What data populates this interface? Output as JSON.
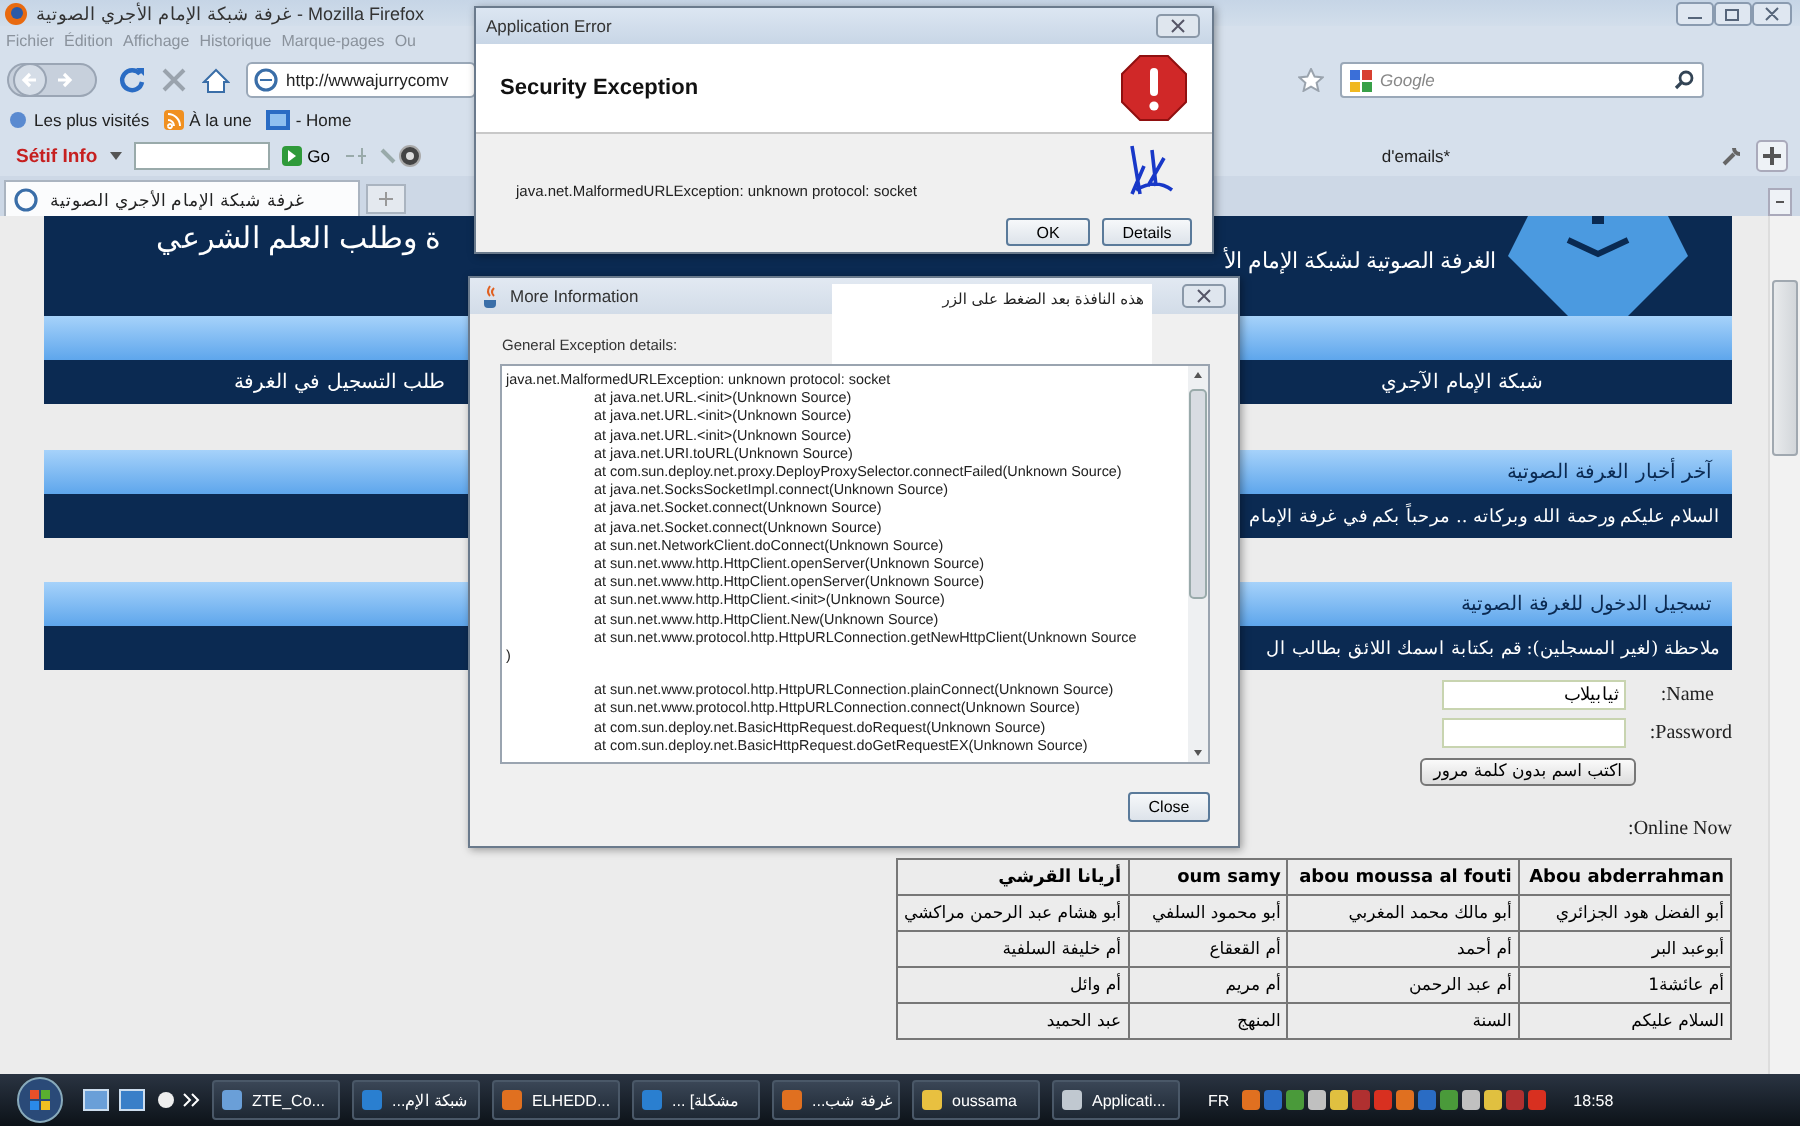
{
  "browser": {
    "title": "غرفة شبكة الإمام الأجري الصوتية - Mozilla Firefox",
    "menu": [
      "Ou",
      "Marque-pages",
      "Historique",
      "Affichage",
      "Édition",
      "Fichier"
    ],
    "address": "http://wwwajurrycomv",
    "search_placeholder": "Google",
    "bookmarks": [
      "- Home",
      "À la une",
      "Les plus visités"
    ],
    "toolbar": {
      "brand": "Sétif Info",
      "go": "Go",
      "right_text": "d'emails*"
    },
    "tabs": [
      {
        "label": "غرفة شبكة الإمام الأجري الصوتية",
        "selected": true
      }
    ]
  },
  "page": {
    "header_left": "ة وطلب العلم الشرعي",
    "header_right": "الغرفة الصوتية لشبكة الإمام الأ",
    "nav": [
      "شبكة الإمام الآجري",
      "طلب التسجيل في الغرفة"
    ],
    "news": {
      "heading": "آخر أخبار الغرفة الصوتية",
      "text": "السلام عليكم ورحمة الله وبركاته .. مرحباً بكم في غرفة الإمام"
    },
    "login": {
      "heading": "تسجيل الدخول للغرفة الصوتية",
      "note": "ملاحظة (لغير المسجلين):  قم بكتابة اسمك اللائق بطالب ال",
      "name_label": ":Name",
      "name_value": "ثيابيلاب",
      "password_label": ":Password",
      "button": "اكتب اسم بدون كلمة مرور"
    },
    "online_label": ":Online Now",
    "online_table": {
      "rows": [
        [
          "Abou abderrahman",
          "abou moussa al fouti",
          "oum samy",
          "أريانا القرشي"
        ],
        [
          "أبو الفضل هود الجزائري",
          "أبو مالك محمد المغربي",
          "أبو محمود السلفي",
          "أبو هشام عبد الرحمن مراكشي"
        ],
        [
          "أبوعبد البر",
          "أم أحمد",
          "أم القعقاع",
          "أم خليفة السلفية"
        ],
        [
          "أم عائشة1",
          "أم عبد الرحمن",
          "أم مريم",
          "أم وائل"
        ],
        [
          "السلام عليكم",
          "السنة",
          "المنهج",
          "عبد الحميد"
        ]
      ]
    }
  },
  "error_dialog": {
    "title": "Application Error",
    "heading": "Security Exception",
    "message": "java.net.MalformedURLException: unknown protocol: socket",
    "buttons": [
      "Details",
      "OK"
    ]
  },
  "details_dialog": {
    "title": "More Information",
    "note": "هذه النافذة بعد الضغط على الزر",
    "label": "General Exception details:",
    "button": "Close",
    "lines": [
      {
        "kind": "head",
        "text": "java.net.MalformedURLException: unknown protocol: socket"
      },
      {
        "kind": "frame",
        "text": "at java.net.URL.<init>(Unknown Source)"
      },
      {
        "kind": "frame",
        "text": "at java.net.URL.<init>(Unknown Source)"
      },
      {
        "kind": "frame",
        "text": "at java.net.URL.<init>(Unknown Source)"
      },
      {
        "kind": "frame",
        "text": "at java.net.URI.toURL(Unknown Source)"
      },
      {
        "kind": "frame",
        "text": "at com.sun.deploy.net.proxy.DeployProxySelector.connectFailed(Unknown Source)"
      },
      {
        "kind": "frame",
        "text": "at java.net.SocksSocketImpl.connect(Unknown Source)"
      },
      {
        "kind": "frame",
        "text": "at java.net.Socket.connect(Unknown Source)"
      },
      {
        "kind": "frame",
        "text": "at java.net.Socket.connect(Unknown Source)"
      },
      {
        "kind": "frame",
        "text": "at sun.net.NetworkClient.doConnect(Unknown Source)"
      },
      {
        "kind": "frame",
        "text": "at sun.net.www.http.HttpClient.openServer(Unknown Source)"
      },
      {
        "kind": "frame",
        "text": "at sun.net.www.http.HttpClient.openServer(Unknown Source)"
      },
      {
        "kind": "frame",
        "text": "at sun.net.www.http.HttpClient.<init>(Unknown Source)"
      },
      {
        "kind": "frame",
        "text": "at sun.net.www.http.HttpClient.New(Unknown Source)"
      },
      {
        "kind": "frame",
        "text": "at sun.net.www.protocol.http.HttpURLConnection.getNewHttpClient(Unknown Source"
      },
      {
        "kind": "cont",
        "text": ")"
      },
      {
        "kind": "frame",
        "text": "at sun.net.www.protocol.http.HttpURLConnection.plainConnect(Unknown Source)"
      },
      {
        "kind": "frame",
        "text": "at sun.net.www.protocol.http.HttpURLConnection.connect(Unknown Source)"
      },
      {
        "kind": "frame",
        "text": "at com.sun.deploy.net.BasicHttpRequest.doRequest(Unknown Source)"
      },
      {
        "kind": "frame",
        "text": "at com.sun.deploy.net.BasicHttpRequest.doGetRequestEX(Unknown Source)"
      }
    ]
  },
  "taskbar": {
    "items": [
      "Applicati...",
      "oussama",
      "...غرفة شب",
      "... [مشكلة",
      "ELHEDD...",
      "...شبكة الإم",
      "ZTE_Co..."
    ],
    "language": "FR",
    "clock": "18:58"
  }
}
